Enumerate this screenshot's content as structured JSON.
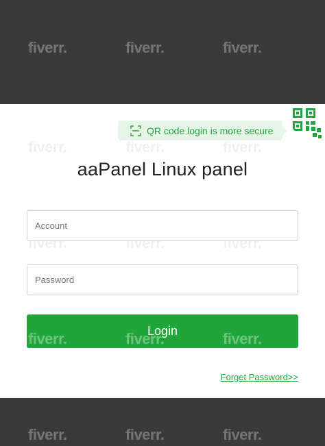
{
  "watermark": "fiverr.",
  "qr_tip": {
    "text": "QR code login is more secure",
    "icon": "scan-icon"
  },
  "qr_toggle": {
    "icon": "qr-code-icon"
  },
  "title": "aaPanel Linux panel",
  "account": {
    "placeholder": "Account",
    "value": ""
  },
  "password": {
    "placeholder": "Password",
    "value": ""
  },
  "login_button": {
    "label": "Login"
  },
  "forget_link": {
    "label": "Forget Password>>"
  },
  "colors": {
    "accent": "#20a53a",
    "tip_bg": "#e6f5e7",
    "backdrop": "#3a3a3a"
  }
}
